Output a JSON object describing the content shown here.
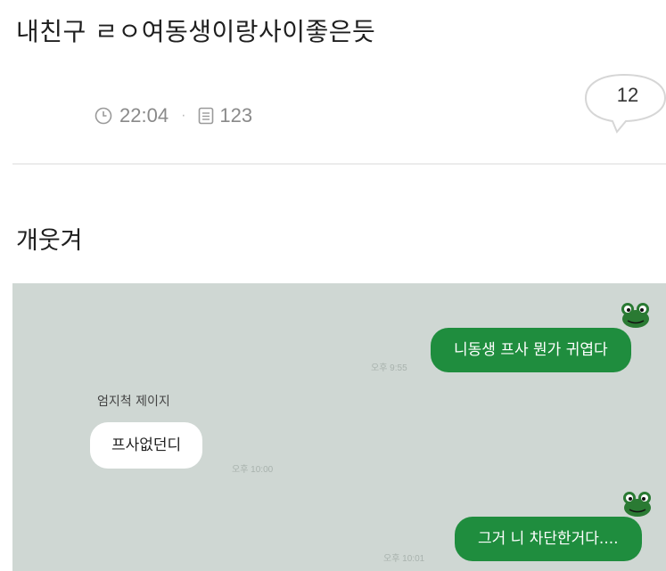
{
  "post": {
    "title": "내친구 ㄹㅇ여동생이랑사이좋은듯",
    "time": "22:04",
    "views": "123",
    "comment_count": "12",
    "body": "개웃겨"
  },
  "icons": {
    "time": "clock-icon",
    "views": "document-icon",
    "comments": "speech-bubble-icon",
    "sticker": "frog-sticker-icon"
  },
  "chat": {
    "background": "#cfd7d3",
    "bubble_color": "#1f8d3e",
    "messages": [
      {
        "direction": "out",
        "text": "니동생 프사 뭔가 귀엽다",
        "time": "오후 9:55"
      },
      {
        "direction": "in",
        "sender": "엄지척 제이지",
        "text": "프사없던디",
        "time": "오후 10:00"
      },
      {
        "direction": "out",
        "text": "그거 니 차단한거다....",
        "time": "오후 10:01"
      }
    ]
  }
}
